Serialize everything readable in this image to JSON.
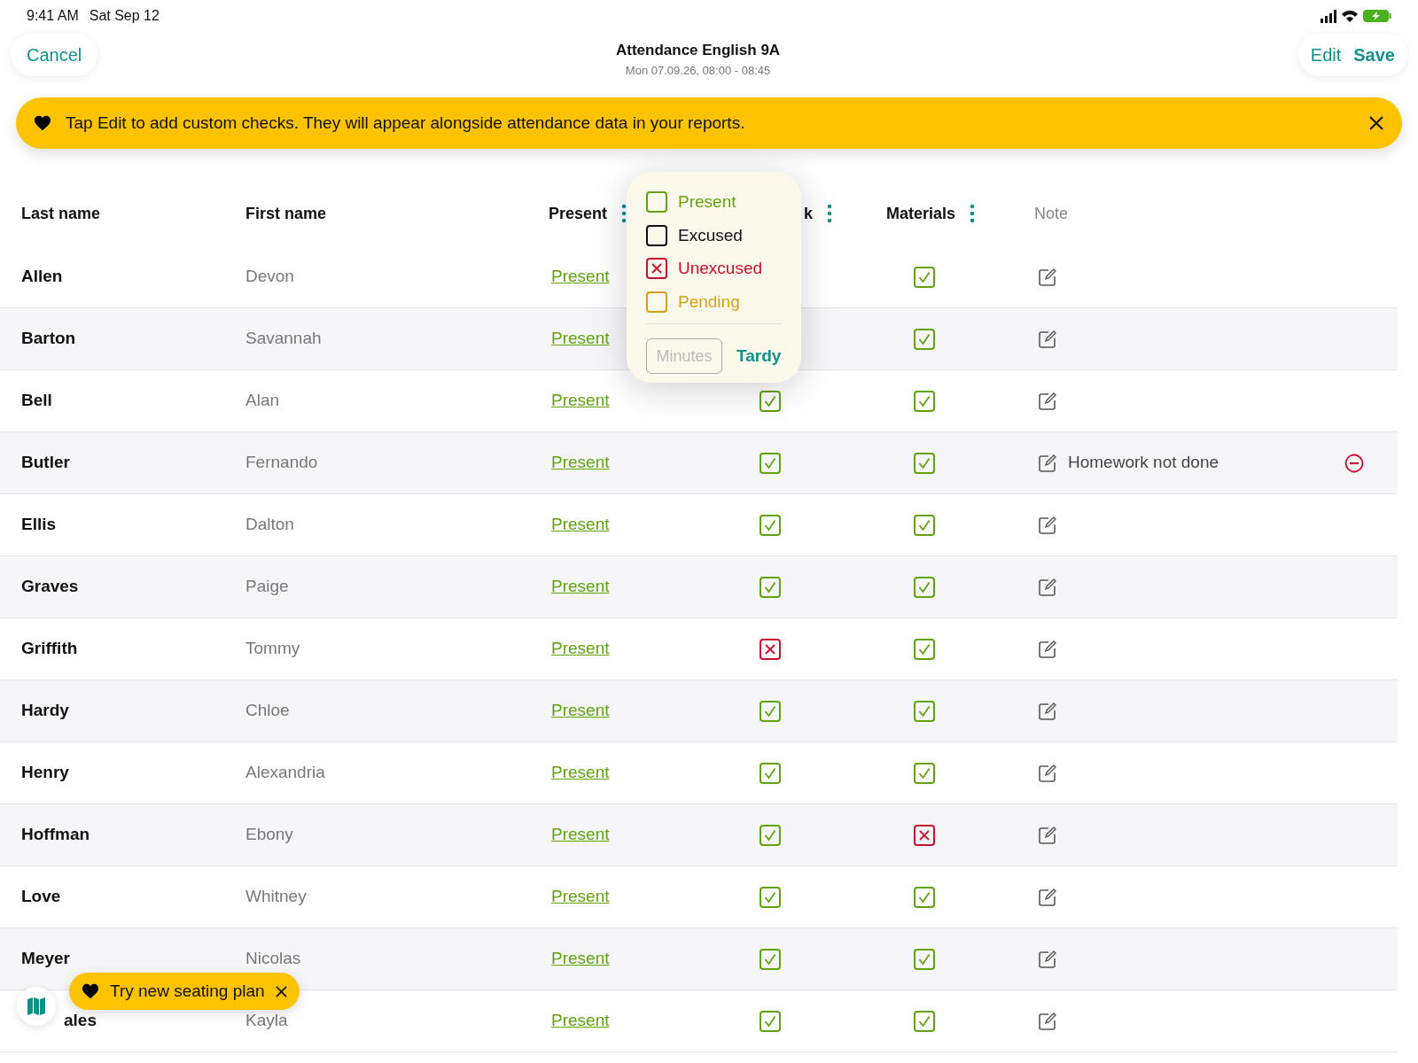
{
  "status_bar": {
    "time": "9:41 AM",
    "date": "Sat Sep 12"
  },
  "header": {
    "cancel": "Cancel",
    "title": "Attendance English 9A",
    "subtitle": "Mon 07.09.26, 08:00 - 08:45",
    "edit": "Edit",
    "save": "Save"
  },
  "banner": {
    "text": "Tap Edit to add custom checks. They will appear alongside attendance data in your reports."
  },
  "table": {
    "columns": [
      {
        "label": "Last name",
        "menu": false
      },
      {
        "label": "First name",
        "menu": false
      },
      {
        "label": "Present",
        "menu": true
      },
      {
        "label": "k",
        "menu": true
      },
      {
        "label": "Materials",
        "menu": true
      },
      {
        "label": "Note",
        "menu": false
      }
    ],
    "rows": [
      {
        "last_name": "Allen",
        "first_name": "Devon",
        "attendance": "Present",
        "materials_checked": true
      },
      {
        "last_name": "Barton",
        "first_name": "Savannah",
        "attendance": "Present",
        "materials_checked": true
      },
      {
        "last_name": "Bell",
        "first_name": "Alan",
        "attendance": "Present",
        "homework_checked": true,
        "materials_checked": true
      },
      {
        "last_name": "Butler",
        "first_name": "Fernando",
        "attendance": "Present",
        "homework_checked": true,
        "materials_checked": true,
        "note": "Homework not done"
      },
      {
        "last_name": "Ellis",
        "first_name": "Dalton",
        "attendance": "Present",
        "homework_checked": true,
        "materials_checked": true
      },
      {
        "last_name": "Graves",
        "first_name": "Paige",
        "attendance": "Present",
        "homework_checked": true,
        "materials_checked": true
      },
      {
        "last_name": "Griffith",
        "first_name": "Tommy",
        "attendance": "Present",
        "homework_checked": false,
        "materials_checked": true
      },
      {
        "last_name": "Hardy",
        "first_name": "Chloe",
        "attendance": "Present",
        "homework_checked": true,
        "materials_checked": true
      },
      {
        "last_name": "Henry",
        "first_name": "Alexandria",
        "attendance": "Present",
        "homework_checked": true,
        "materials_checked": true
      },
      {
        "last_name": "Hoffman",
        "first_name": "Ebony",
        "attendance": "Present",
        "homework_checked": true,
        "materials_checked": false
      },
      {
        "last_name": "Love",
        "first_name": "Whitney",
        "attendance": "Present",
        "homework_checked": true,
        "materials_checked": true
      },
      {
        "last_name": "Meyer",
        "first_name": "Nicolas",
        "attendance": "Present",
        "homework_checked": true,
        "materials_checked": true
      },
      {
        "last_name": "ales",
        "first_name": "Kayla",
        "attendance": "Present",
        "homework_checked": true,
        "materials_checked": true
      }
    ]
  },
  "popover": {
    "options": [
      {
        "label": "Present",
        "color": "#5fa30f",
        "checked": false
      },
      {
        "label": "Excused",
        "color": "#111111",
        "checked": false
      },
      {
        "label": "Unexcused",
        "color": "#c8102e",
        "checked": true
      },
      {
        "label": "Pending",
        "color": "#d4a017",
        "checked": false
      }
    ],
    "minutes_placeholder": "Minutes",
    "tardy": "Tardy"
  },
  "seating_tip": {
    "text": "Try new seating plan"
  }
}
